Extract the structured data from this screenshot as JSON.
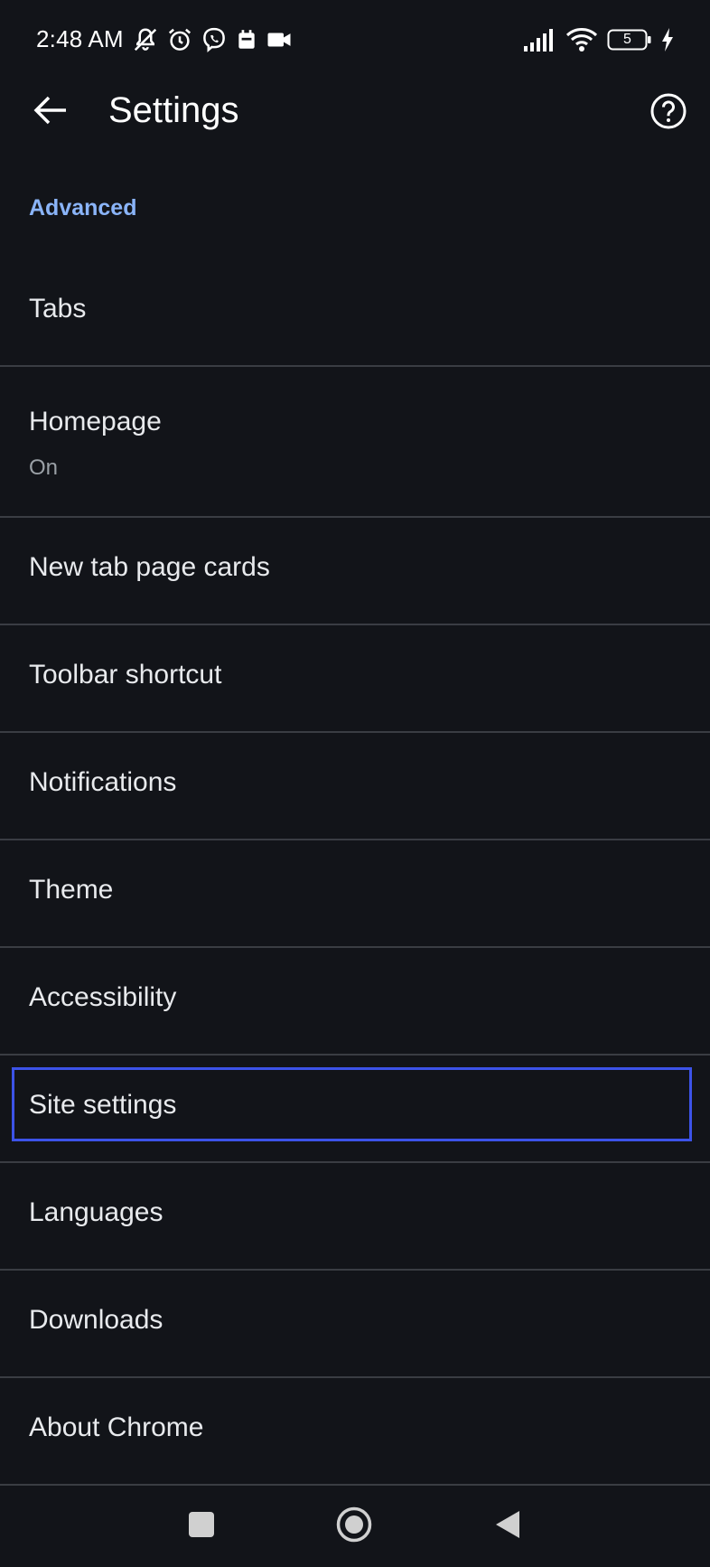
{
  "status_bar": {
    "time": "2:48 AM",
    "battery_level": "5",
    "icons": [
      "notifications-off-icon",
      "alarm-icon",
      "viber-icon",
      "calendar-icon",
      "video-camera-icon",
      "signal-icon",
      "wifi-icon",
      "battery-icon",
      "charging-bolt-icon"
    ]
  },
  "app_bar": {
    "title": "Settings",
    "back_icon": "arrow-left-icon",
    "help_icon": "help-circle-icon"
  },
  "section": {
    "header": "Advanced"
  },
  "items": [
    {
      "title": "Tabs"
    },
    {
      "title": "Homepage",
      "subtitle": "On"
    },
    {
      "title": "New tab page cards"
    },
    {
      "title": "Toolbar shortcut"
    },
    {
      "title": "Notifications"
    },
    {
      "title": "Theme"
    },
    {
      "title": "Accessibility"
    },
    {
      "title": "Site settings",
      "highlighted": true
    },
    {
      "title": "Languages"
    },
    {
      "title": "Downloads"
    },
    {
      "title": "About Chrome"
    }
  ],
  "nav_bar": {
    "icons": [
      "recents-square-icon",
      "home-circle-icon",
      "back-triangle-icon"
    ]
  },
  "colors": {
    "background": "#121419",
    "accent": "#8ab4f8",
    "highlight_border": "#3c53e8",
    "divider": "#3a3d43"
  }
}
